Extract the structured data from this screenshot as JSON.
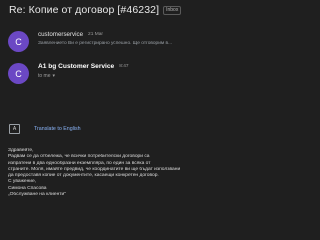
{
  "header": {
    "subject": "Re: Копие от договор [#46232]",
    "label": "Inbox"
  },
  "messages": [
    {
      "avatar_letter": "C",
      "sender": "customerservice",
      "time": "21 Mar",
      "snippet": "Заявлението Ви е регистрирано успешно. Ще отговорим в..."
    },
    {
      "avatar_letter": "C",
      "sender": "A1 bg Customer Service",
      "time": "8:47",
      "to": "to me"
    }
  ],
  "translate": {
    "label": "Translate to English"
  },
  "body": {
    "lines": [
      "Здравейте,",
      "Радвам се да отбележа, че всички потребителски договори са",
      "изпратени в два еднообразни екземпляра, по един за всяка от",
      "страните. Моля, имайте предвид, че координатите ви ще бъдат използвани",
      "да предоставя копие от документите, касаещи конкретен договор.",
      "С уважение,",
      "Симона Спасова",
      "„Обслужване на клиенти“"
    ]
  },
  "colors": {
    "background": "#1f1f1f",
    "avatar": "#6b48c4",
    "link": "#8ab4f8"
  }
}
